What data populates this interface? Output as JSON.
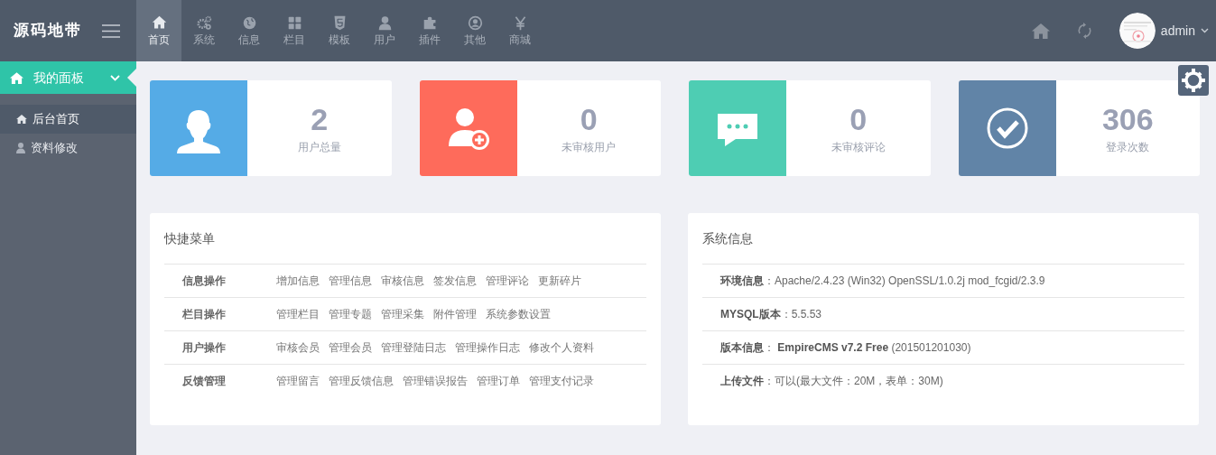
{
  "logo": "源码地带",
  "nav": [
    {
      "label": "首页",
      "selected": true
    },
    {
      "label": "系统",
      "selected": false
    },
    {
      "label": "信息",
      "selected": false
    },
    {
      "label": "栏目",
      "selected": false
    },
    {
      "label": "模板",
      "selected": false
    },
    {
      "label": "用户",
      "selected": false
    },
    {
      "label": "插件",
      "selected": false
    },
    {
      "label": "其他",
      "selected": false
    },
    {
      "label": "商城",
      "selected": false
    }
  ],
  "user": {
    "name": "admin"
  },
  "sidebar": {
    "header": "我的面板",
    "expanded": true,
    "items": [
      {
        "label": "后台首页",
        "selected": true
      },
      {
        "label": "资料修改",
        "selected": false
      }
    ]
  },
  "stats": [
    {
      "value": "2",
      "label": "用户总量",
      "color": "#55abe6"
    },
    {
      "value": "0",
      "label": "未审核用户",
      "color": "#fe6b5b"
    },
    {
      "value": "0",
      "label": "未审核评论",
      "color": "#4ecdb3"
    },
    {
      "value": "306",
      "label": "登录次数",
      "color": "#6184a7"
    }
  ],
  "quick_menu": {
    "title": "快捷菜单",
    "rows": [
      {
        "category": "信息操作",
        "links": [
          "增加信息",
          "管理信息",
          "审核信息",
          "签发信息",
          "管理评论",
          "更新碎片"
        ]
      },
      {
        "category": "栏目操作",
        "links": [
          "管理栏目",
          "管理专题",
          "管理采集",
          "附件管理",
          "系统参数设置"
        ]
      },
      {
        "category": "用户操作",
        "links": [
          "审核会员",
          "管理会员",
          "管理登陆日志",
          "管理操作日志",
          "修改个人资料"
        ]
      },
      {
        "category": "反馈管理",
        "links": [
          "管理留言",
          "管理反馈信息",
          "管理错误报告",
          "管理订单",
          "管理支付记录"
        ]
      }
    ]
  },
  "system_info": {
    "title": "系统信息",
    "rows": [
      "**环境信息**：Apache/2.4.23 (Win32) OpenSSL/1.0.2j mod_fcgid/2.3.9",
      "**MYSQL版本**：5.5.53",
      "**版本信息**： **EmpireCMS v7.2 Free** (201501201030)",
      "**上传文件**：可以(最大文件：20M，表单：30M)"
    ]
  }
}
